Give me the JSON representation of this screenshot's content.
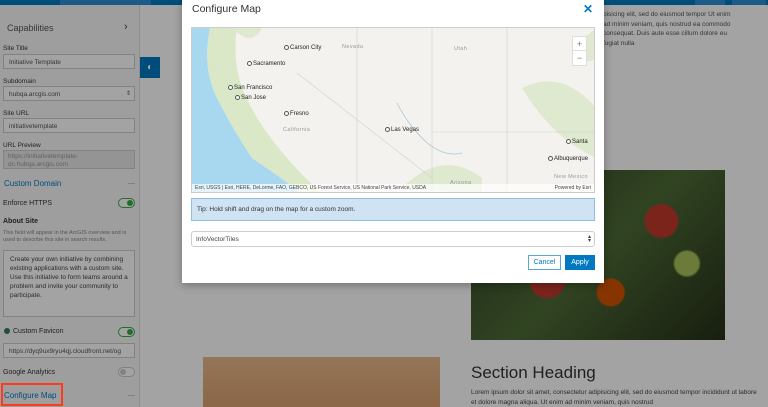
{
  "sidebar": {
    "capabilities": "Capabilities",
    "site_title_label": "Site Title",
    "site_title_value": "Initiative Template",
    "subdomain_label": "Subdomain",
    "subdomain_value": "hubqa.arcgis.com",
    "site_url_label": "Site URL",
    "site_url_value": "initiativetemplate",
    "url_preview_label": "URL Preview",
    "url_preview_value": "https://initiativetemplate-dc.hubqa.arcgis.com",
    "custom_domain": "Custom Domain",
    "enforce_https": "Enforce HTTPS",
    "enforce_https_on": true,
    "about_label": "About Site",
    "about_help": "This field will appear in the ArcGIS overview and is used to describe this site in search results.",
    "about_value": "Create your own initiative by combining existing applications with a custom site. Use this initiative to form teams around a problem and invite your community to participate.",
    "custom_favicon": "Custom Favicon",
    "custom_favicon_on": true,
    "favicon_url": "https://dyq9ux9ryu4qj.cloudfront.net/og",
    "google_analytics": "Google Analytics",
    "google_analytics_on": false,
    "configure_map": "Configure Map",
    "collapse": "—"
  },
  "main": {
    "top_text": "pisicing elit, sed do eiusmod tempor Ut enim ad minim veniam, quis nostrud ea commodo consequat. Duis aute esse cillum dolore eu fugiat nulla",
    "section_heading": "Section Heading",
    "section_text": "Lorem ipsum dolor sit amet, consectetur adipisicing elit, sed do eiusmod tempor incididunt ut labore et dolore magna aliqua. Ut enim ad minim veniam, quis nostrud"
  },
  "modal": {
    "title": "Configure Map",
    "close": "✕",
    "map": {
      "cities": [
        "Carson City",
        "Sacramento",
        "San Francisco",
        "San Jose",
        "Fresno",
        "Las Vegas",
        "Santa",
        "Albuquerque"
      ],
      "states": [
        "Nevada",
        "Utah",
        "California",
        "Arizona",
        "New Mexico"
      ],
      "zoom_in": "+",
      "zoom_out": "−",
      "attribution": "Esri, USGS | Esri, HERE, DeLorme, FAO, GEBCO, US Forest Service, US National Park Service, USDA",
      "powered_by": "Powered by Esri"
    },
    "tip": "Tip: Hold shift and drag on the map for a custom zoom.",
    "basemap_select": "InfoVectorTiles",
    "cancel": "Cancel",
    "apply": "Apply"
  }
}
